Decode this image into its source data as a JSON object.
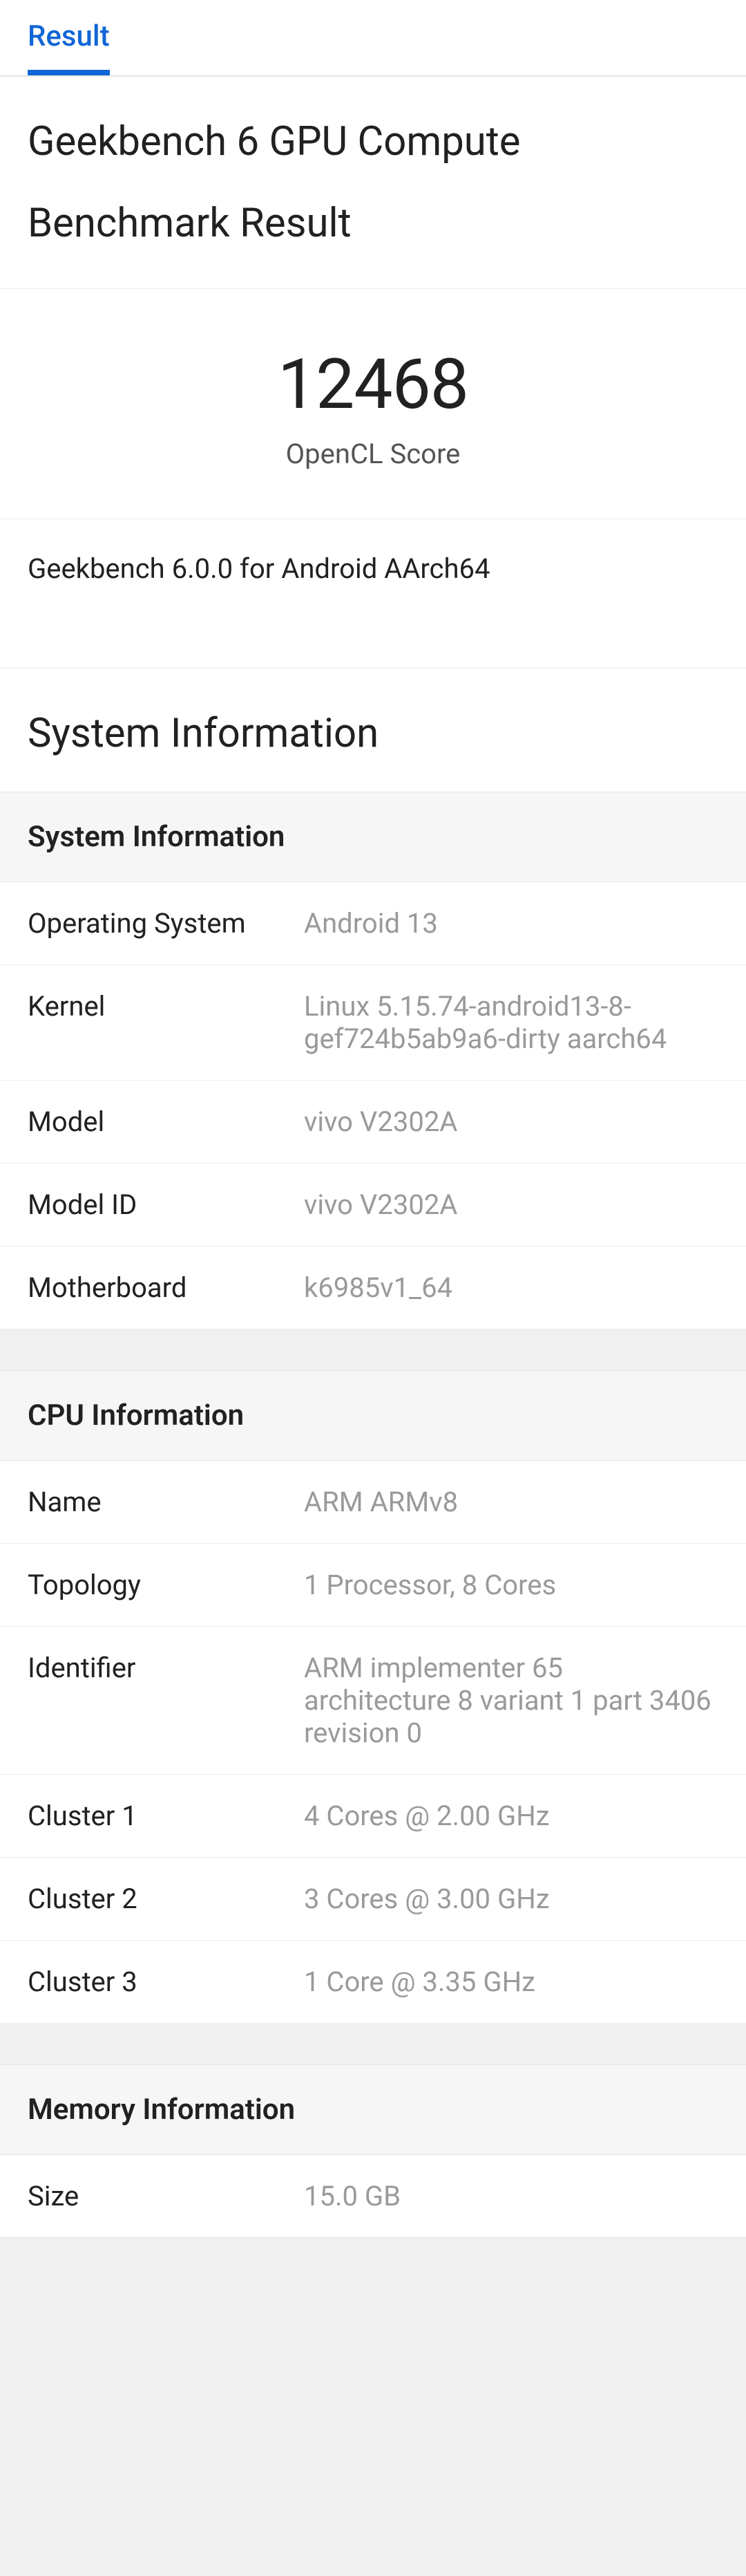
{
  "tab": {
    "label": "Result"
  },
  "header": {
    "title_line1": "Geekbench 6 GPU Compute",
    "title_line2": "Benchmark Result"
  },
  "score": {
    "value": "12468",
    "label": "OpenCL Score"
  },
  "version": "Geekbench 6.0.0 for Android AArch64",
  "section_heading": "System Information",
  "groups": [
    {
      "title": "System Information",
      "rows": [
        {
          "label": "Operating System",
          "value": "Android 13"
        },
        {
          "label": "Kernel",
          "value": "Linux 5.15.74-android13-8-gef724b5ab9a6-dirty aarch64"
        },
        {
          "label": "Model",
          "value": "vivo V2302A"
        },
        {
          "label": "Model ID",
          "value": "vivo V2302A"
        },
        {
          "label": "Motherboard",
          "value": "k6985v1_64"
        }
      ]
    },
    {
      "title": "CPU Information",
      "rows": [
        {
          "label": "Name",
          "value": "ARM ARMv8"
        },
        {
          "label": "Topology",
          "value": "1 Processor, 8 Cores"
        },
        {
          "label": "Identifier",
          "value": "ARM implementer 65 architecture 8 variant 1 part 3406 revision 0"
        },
        {
          "label": "Cluster 1",
          "value": "4 Cores @ 2.00 GHz"
        },
        {
          "label": "Cluster 2",
          "value": "3 Cores @ 3.00 GHz"
        },
        {
          "label": "Cluster 3",
          "value": "1 Core @ 3.35 GHz"
        }
      ]
    },
    {
      "title": "Memory Information",
      "rows": [
        {
          "label": "Size",
          "value": "15.0 GB"
        }
      ]
    }
  ]
}
